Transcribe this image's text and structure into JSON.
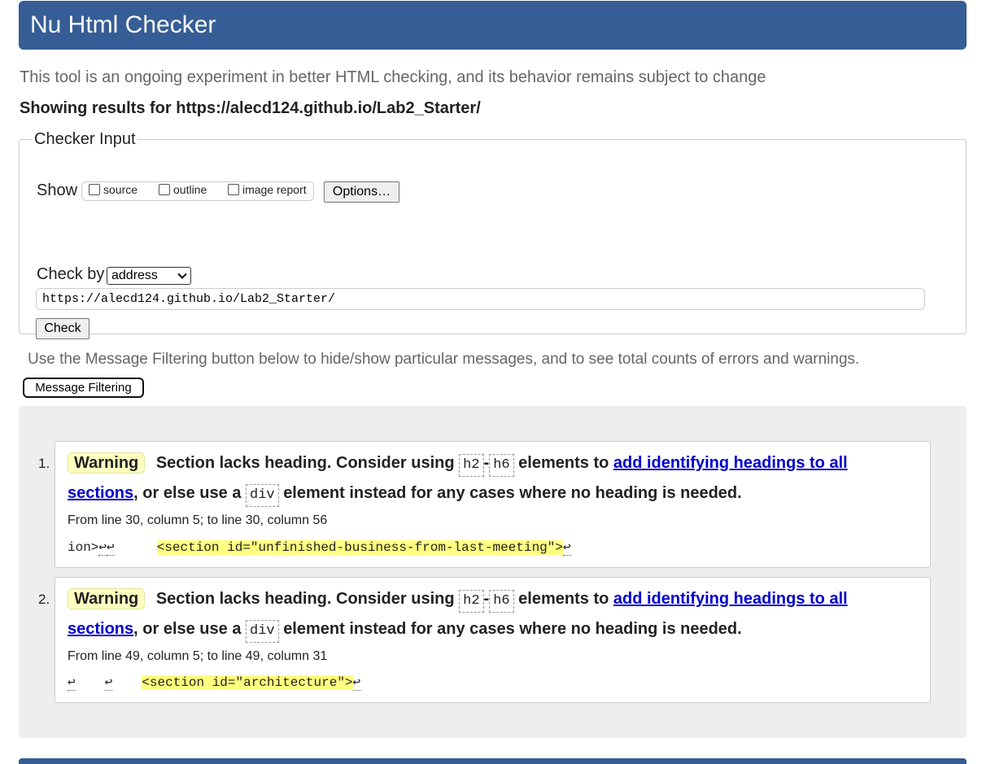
{
  "header": {
    "title": "Nu Html Checker"
  },
  "tagline": "This tool is an ongoing experiment in better HTML checking, and its behavior remains subject to change",
  "results_for": "Showing results for https://alecd124.github.io/Lab2_Starter/",
  "checker_input": {
    "legend": "Checker Input",
    "show_label": "Show",
    "show_options": [
      "source",
      "outline",
      "image report"
    ],
    "options_button": "Options…",
    "check_by_label": "Check by",
    "check_by_value": "address",
    "url_value": "https://alecd124.github.io/Lab2_Starter/",
    "check_button": "Check"
  },
  "filter_hint": "Use the Message Filtering button below to hide/show particular messages, and to see total counts of errors and warnings.",
  "filter_button": "Message Filtering",
  "messages": [
    {
      "number": "1.",
      "type": "Warning",
      "text_a": "Section lacks heading. Consider using",
      "code_1": "h2",
      "dash": "-",
      "code_2": "h6",
      "text_b": "elements to",
      "link_a": "add identifying headings to all",
      "link_b": "sections",
      "text_c": ", or else use a",
      "code_3": "div",
      "text_d": "element instead for any cases where no heading is needed.",
      "location": "From line 30, column 5; to line 30, column 56",
      "extract_prefix": "ion>",
      "extract_code": "<section id=\"unfinished-business-from-last-meeting\">"
    },
    {
      "number": "2.",
      "type": "Warning",
      "text_a": "Section lacks heading. Consider using",
      "code_1": "h2",
      "dash": "-",
      "code_2": "h6",
      "text_b": "elements to",
      "link_a": "add identifying headings to all",
      "link_b": "sections",
      "text_c": ", or else use a",
      "code_3": "div",
      "text_d": "element instead for any cases where no heading is needed.",
      "location": "From line 49, column 5; to line 49, column 31",
      "extract_prefix": "",
      "extract_code": "<section id=\"architecture\">"
    }
  ],
  "glyphs": {
    "line_feed": "↩"
  },
  "colors": {
    "header": "#365d95",
    "warning_badge": "#ffffc0",
    "highlight": "#ffff80",
    "link": "#0000cc"
  }
}
